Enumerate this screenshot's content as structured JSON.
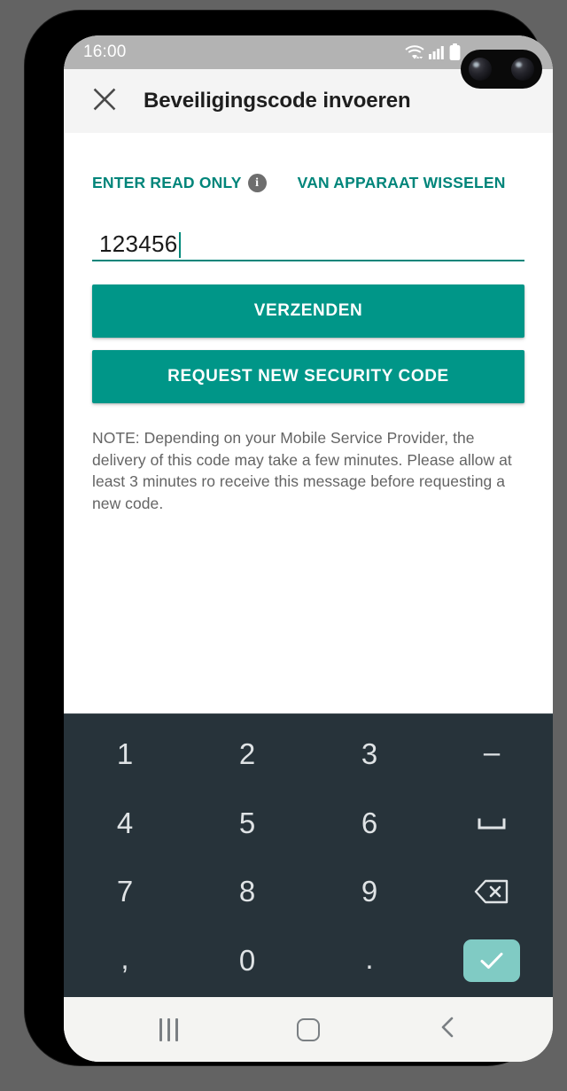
{
  "statusbar": {
    "time": "16:00",
    "icons": [
      "wifi-icon",
      "cellular-signal-icon",
      "battery-icon"
    ]
  },
  "appbar": {
    "close_icon": "close-icon",
    "title": "Beveiligingscode invoeren"
  },
  "content": {
    "read_only_link": "ENTER READ ONLY",
    "info_icon_label": "i",
    "switch_device_link": "VAN APPARAAT WISSELEN",
    "code_input": {
      "value": "123456",
      "placeholder": ""
    },
    "submit_label": "VERZENDEN",
    "request_label": "REQUEST NEW SECURITY CODE",
    "note": "NOTE: Depending on your Mobile Service Provider, the delivery of this code may take a few minutes. Please allow at least 3 minutes ro receive this message before requesting a new code."
  },
  "keypad": {
    "rows": [
      [
        {
          "label": "1",
          "name": "key-1",
          "kind": "digit"
        },
        {
          "label": "2",
          "name": "key-2",
          "kind": "digit"
        },
        {
          "label": "3",
          "name": "key-3",
          "kind": "digit"
        },
        {
          "label": "–",
          "name": "key-dash",
          "kind": "punct"
        }
      ],
      [
        {
          "label": "4",
          "name": "key-4",
          "kind": "digit"
        },
        {
          "label": "5",
          "name": "key-5",
          "kind": "digit"
        },
        {
          "label": "6",
          "name": "key-6",
          "kind": "digit"
        },
        {
          "label": "␣",
          "name": "key-space",
          "kind": "icon-space"
        }
      ],
      [
        {
          "label": "7",
          "name": "key-7",
          "kind": "digit"
        },
        {
          "label": "8",
          "name": "key-8",
          "kind": "digit"
        },
        {
          "label": "9",
          "name": "key-9",
          "kind": "digit"
        },
        {
          "label": "",
          "name": "key-backspace",
          "kind": "icon-backspace"
        }
      ],
      [
        {
          "label": ",",
          "name": "key-comma",
          "kind": "punct"
        },
        {
          "label": "0",
          "name": "key-0",
          "kind": "digit"
        },
        {
          "label": ".",
          "name": "key-period",
          "kind": "punct"
        },
        {
          "label": "",
          "name": "key-enter",
          "kind": "icon-enter"
        }
      ]
    ]
  },
  "navbar": {
    "recents_label": "recents-icon",
    "home_label": "home-icon",
    "back_label": "back-icon"
  },
  "colors": {
    "accent": "#009688",
    "link": "#00857a",
    "keypad_bg": "#27333a",
    "enter_key": "#80cbc4",
    "statusbar_bg": "#b3b3b3",
    "appbar_bg": "#f4f4f4",
    "note_text": "#646464"
  }
}
